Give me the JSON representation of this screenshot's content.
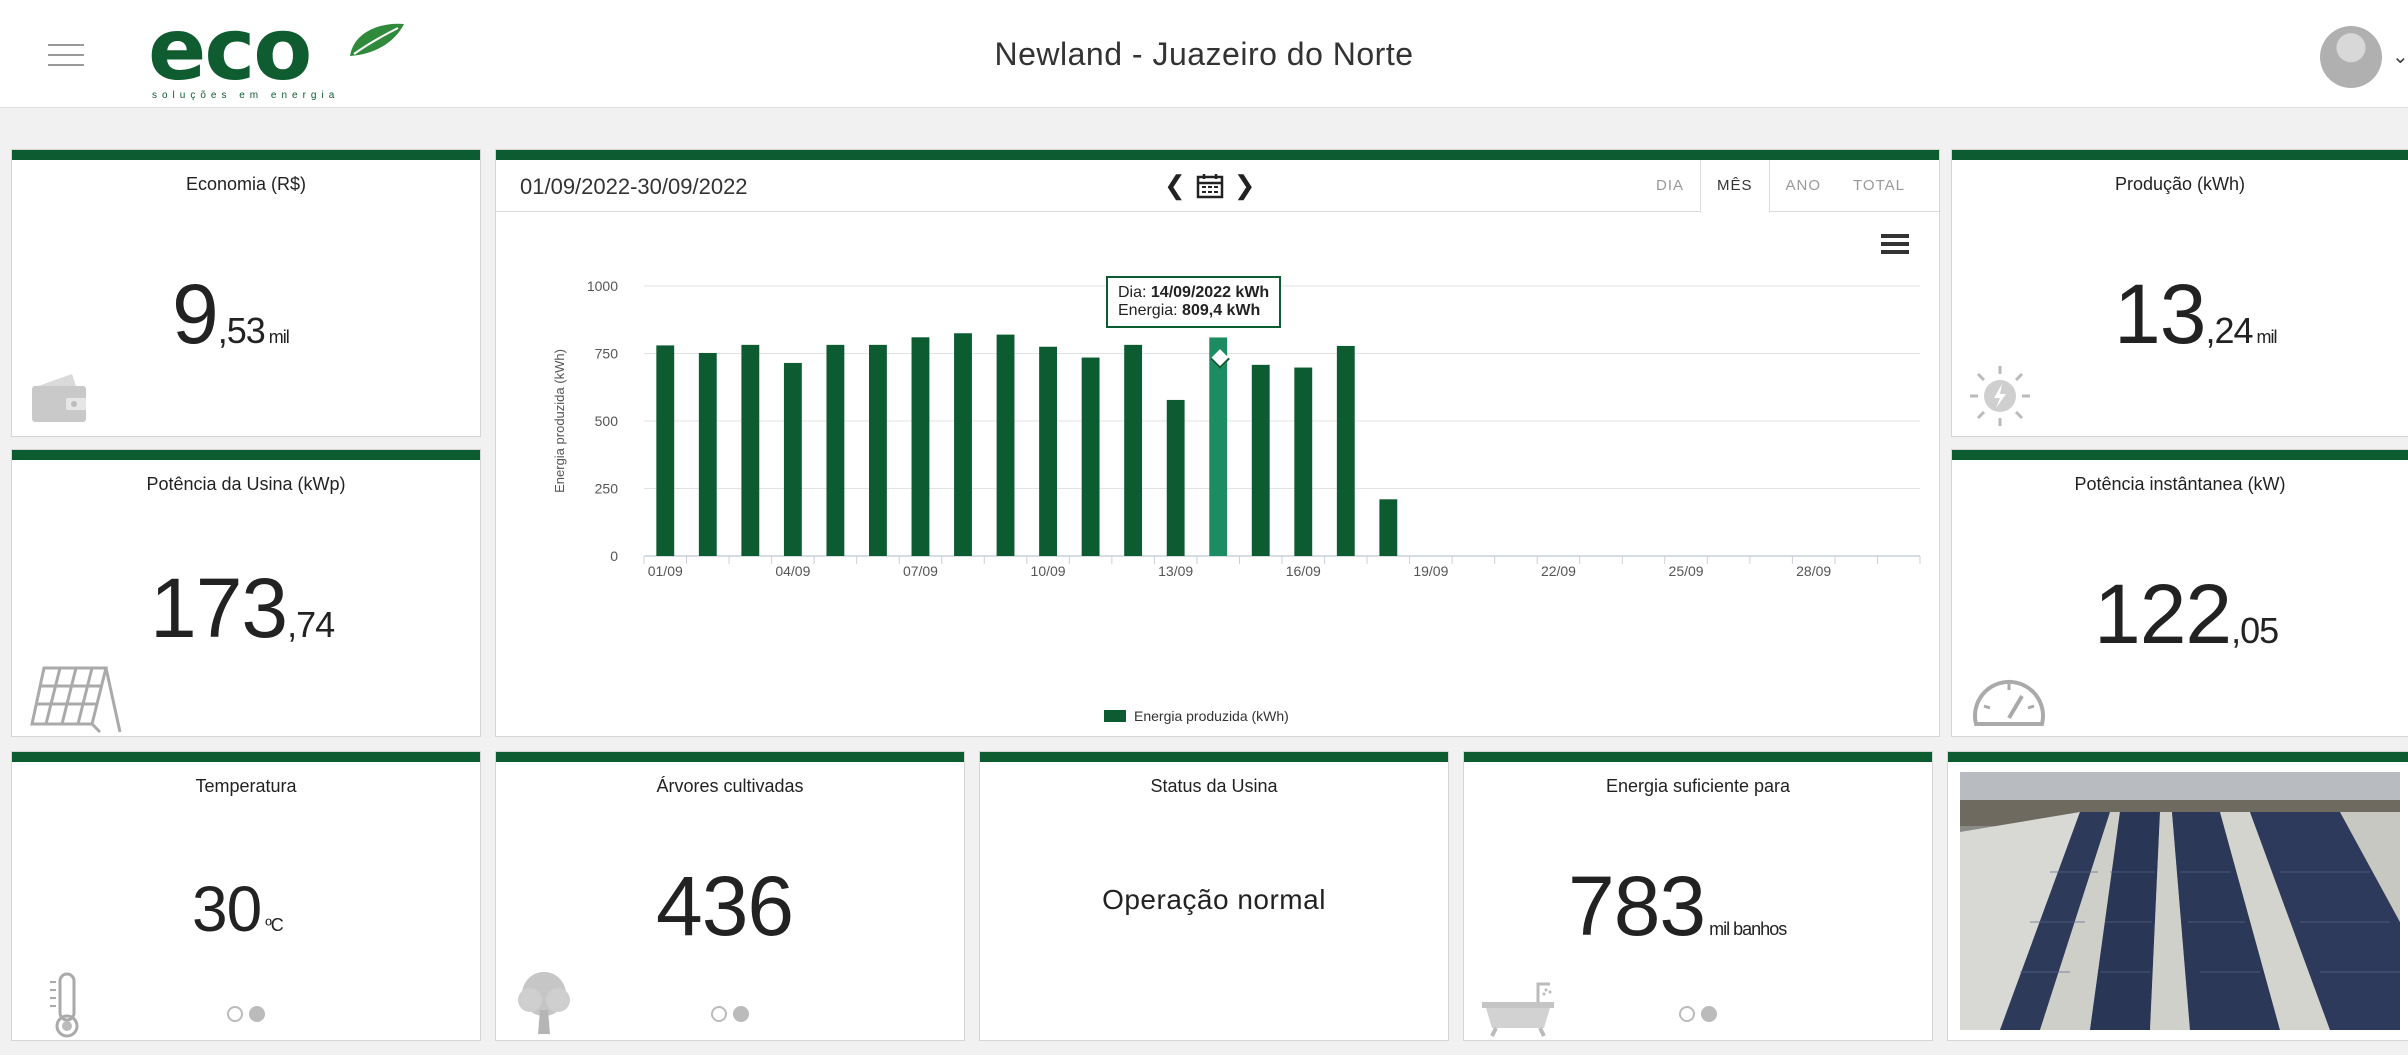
{
  "header": {
    "logo_text": "eco",
    "logo_sub": "soluções em energia",
    "title": "Newland - Juazeiro do Norte"
  },
  "economia": {
    "title": "Economia (R$)",
    "int": "9",
    "dec": ",53",
    "unit": "mil"
  },
  "potencia_usina": {
    "title": "Potência da Usina (kWp)",
    "int": "173",
    "dec": ",74"
  },
  "producao": {
    "title": "Produção (kWh)",
    "int": "13",
    "dec": ",24",
    "unit": "mil"
  },
  "potencia_inst": {
    "title": "Potência instântanea (kW)",
    "int": "122",
    "dec": ",05"
  },
  "temperatura": {
    "title": "Temperatura",
    "value": "30",
    "unit": "ºC"
  },
  "arvores": {
    "title": "Árvores cultivadas",
    "value": "436"
  },
  "status": {
    "title": "Status da Usina",
    "value": "Operação normal"
  },
  "energia_suf": {
    "title": "Energia suficiente para",
    "value": "783",
    "unit": "mil banhos"
  },
  "chart_panel": {
    "date_range": "01/09/2022-30/09/2022",
    "tabs": [
      "DIA",
      "MÊS",
      "ANO",
      "TOTAL"
    ],
    "active_tab": "MÊS",
    "tooltip": {
      "day_label": "Dia:",
      "day_value": "14/09/2022 kWh",
      "energy_label": "Energia:",
      "energy_value": "809,4 kWh"
    }
  },
  "colors": {
    "brand": "#0d5c31",
    "highlight": "#1e8c62"
  },
  "chart_data": {
    "type": "bar",
    "ylabel": "Energia produzida (kWh)",
    "ylim": [
      0,
      1000
    ],
    "yticks": [
      0,
      250,
      500,
      750,
      1000
    ],
    "xtick_labels": [
      "01/09",
      "04/09",
      "07/09",
      "10/09",
      "13/09",
      "16/09",
      "19/09",
      "22/09",
      "25/09",
      "28/09"
    ],
    "categories": [
      "01/09",
      "02/09",
      "03/09",
      "04/09",
      "05/09",
      "06/09",
      "07/09",
      "08/09",
      "09/09",
      "10/09",
      "11/09",
      "12/09",
      "13/09",
      "14/09",
      "15/09",
      "16/09",
      "17/09",
      "18/09",
      "19/09",
      "20/09",
      "21/09",
      "22/09",
      "23/09",
      "24/09",
      "25/09",
      "26/09",
      "27/09",
      "28/09",
      "29/09",
      "30/09"
    ],
    "series": [
      {
        "name": "Energia produzida (kWh)",
        "values": [
          780,
          752,
          782,
          715,
          782,
          782,
          810,
          825,
          820,
          775,
          735,
          782,
          578,
          809.4,
          708,
          698,
          778,
          210,
          0,
          0,
          0,
          0,
          0,
          0,
          0,
          0,
          0,
          0,
          0,
          0
        ]
      }
    ],
    "highlight_index": 13,
    "grid": true,
    "legend_position": "bottom"
  }
}
